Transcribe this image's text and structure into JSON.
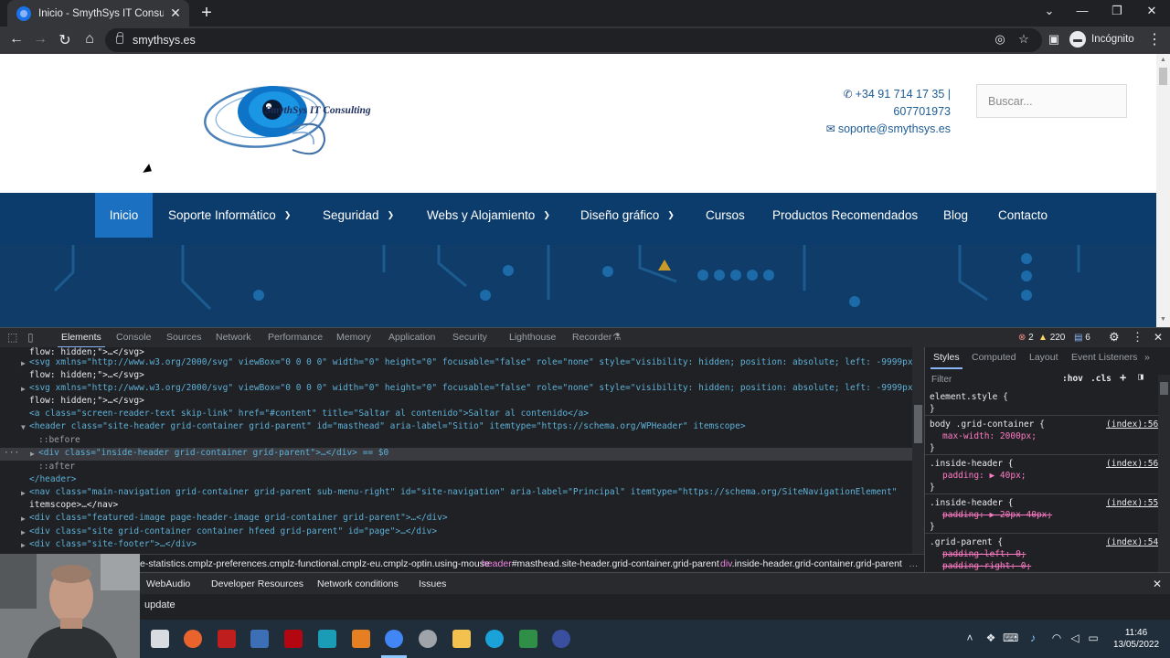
{
  "browser": {
    "tab_title": "Inicio - SmythSys IT Consulting. C",
    "tab_close": "✕",
    "new_tab": "+",
    "url": "smythsys.es",
    "profile_label": "Incógnito",
    "window_controls": [
      "⌄",
      "—",
      "❐",
      "✕"
    ]
  },
  "site": {
    "logo_text": "SmythSys IT Consulting",
    "phone": "+34 91 714 17 35 | 607701973",
    "email": "soporte@smythsys.es",
    "search_placeholder": "Buscar...",
    "nav": [
      {
        "label": "Inicio",
        "has_submenu": false,
        "active": true
      },
      {
        "label": "Soporte Informático",
        "has_submenu": true,
        "active": false
      },
      {
        "label": "Seguridad",
        "has_submenu": true,
        "active": false
      },
      {
        "label": "Webs y Alojamiento",
        "has_submenu": true,
        "active": false
      },
      {
        "label": "Diseño gráfico",
        "has_submenu": true,
        "active": false
      },
      {
        "label": "Cursos",
        "has_submenu": false,
        "active": false
      },
      {
        "label": "Productos Recomendados",
        "has_submenu": false,
        "active": false
      },
      {
        "label": "Blog",
        "has_submenu": false,
        "active": false
      },
      {
        "label": "Contacto",
        "has_submenu": false,
        "active": false
      }
    ],
    "colors": {
      "nav_bg": "#0c3c6b",
      "nav_active": "#1c70c1",
      "hero_bg": "#0f3c68"
    }
  },
  "devtools": {
    "tabs": [
      "Elements",
      "Console",
      "Sources",
      "Network",
      "Performance",
      "Memory",
      "Application",
      "Security",
      "Lighthouse",
      "Recorder"
    ],
    "active_tab": "Elements",
    "errors": "2",
    "warnings": "220",
    "messages": "6",
    "dom_lines": [
      "flow: hidden;\">…</svg>",
      "<svg xmlns=\"http://www.w3.org/2000/svg\" viewBox=\"0 0 0 0\" width=\"0\" height=\"0\" focusable=\"false\" role=\"none\" style=\"visibility: hidden; position: absolute; left: -9999px; over",
      "flow: hidden;\">…</svg>",
      "<svg xmlns=\"http://www.w3.org/2000/svg\" viewBox=\"0 0 0 0\" width=\"0\" height=\"0\" focusable=\"false\" role=\"none\" style=\"visibility: hidden; position: absolute; left: -9999px; over",
      "flow: hidden;\">…</svg>",
      "<a class=\"screen-reader-text skip-link\" href=\"#content\" title=\"Saltar al contenido\">Saltar al contenido</a>",
      "<header class=\"site-header grid-container grid-parent\" id=\"masthead\" aria-label=\"Sitio\" itemtype=\"https://schema.org/WPHeader\" itemscope>",
      "::before",
      "<div class=\"inside-header grid-container grid-parent\">…</div> == $0",
      "::after",
      "</header>",
      "<nav class=\"main-navigation grid-container grid-parent sub-menu-right\" id=\"site-navigation\" aria-label=\"Principal\" itemtype=\"https://schema.org/SiteNavigationElement\"",
      "itemscope>…</nav>",
      "<div class=\"featured-image page-header-image grid-container grid-parent\">…</div>",
      "<div class=\"site grid-container container hfeed grid-parent\" id=\"page\">…</div>",
      "<div class=\"site-footer\">…</div>"
    ],
    "styles_tabs": [
      "Styles",
      "Computed",
      "Layout",
      "Event Listeners"
    ],
    "filter_placeholder": "Filter",
    "hov": ":hov",
    "cls": ".cls",
    "css_rules": [
      {
        "selector": "element.style {",
        "source": "",
        "props": []
      },
      {
        "selector": "body .grid-container {",
        "source": "(index):56",
        "props": [
          {
            "text": "max-width: 2000px;",
            "strike": false
          }
        ]
      },
      {
        "selector": ".inside-header {",
        "source": "(index):56",
        "props": [
          {
            "text": "padding: ▶ 40px;",
            "strike": false
          }
        ]
      },
      {
        "selector": ".inside-header {",
        "source": "(index):55",
        "props": [
          {
            "text": "padding: ▶ 20px 40px;",
            "strike": true
          }
        ]
      },
      {
        "selector": ".grid-parent {",
        "source": "(index):54",
        "props": [
          {
            "text": "padding-left: 0;",
            "strike": true
          },
          {
            "text": "padding-right: 0;",
            "strike": true
          }
        ]
      }
    ],
    "breadcrumbs": [
      {
        "tag": "",
        "cls": "e-statistics.cmplz-preferences.cmplz-functional.cmplz-eu.cmplz-optin.using-mouse"
      },
      {
        "tag": "header",
        "cls": "#masthead.site-header.grid-container.grid-parent"
      },
      {
        "tag": "div",
        "cls": ".inside-header.grid-container.grid-parent"
      }
    ],
    "breadcrumb_more": "…",
    "drawer_tabs": [
      "WebAudio",
      "Developer Resources",
      "Network conditions",
      "Issues"
    ],
    "drawer_text": "update"
  },
  "taskbar": {
    "time": "11:46",
    "date": "13/05/2022"
  }
}
